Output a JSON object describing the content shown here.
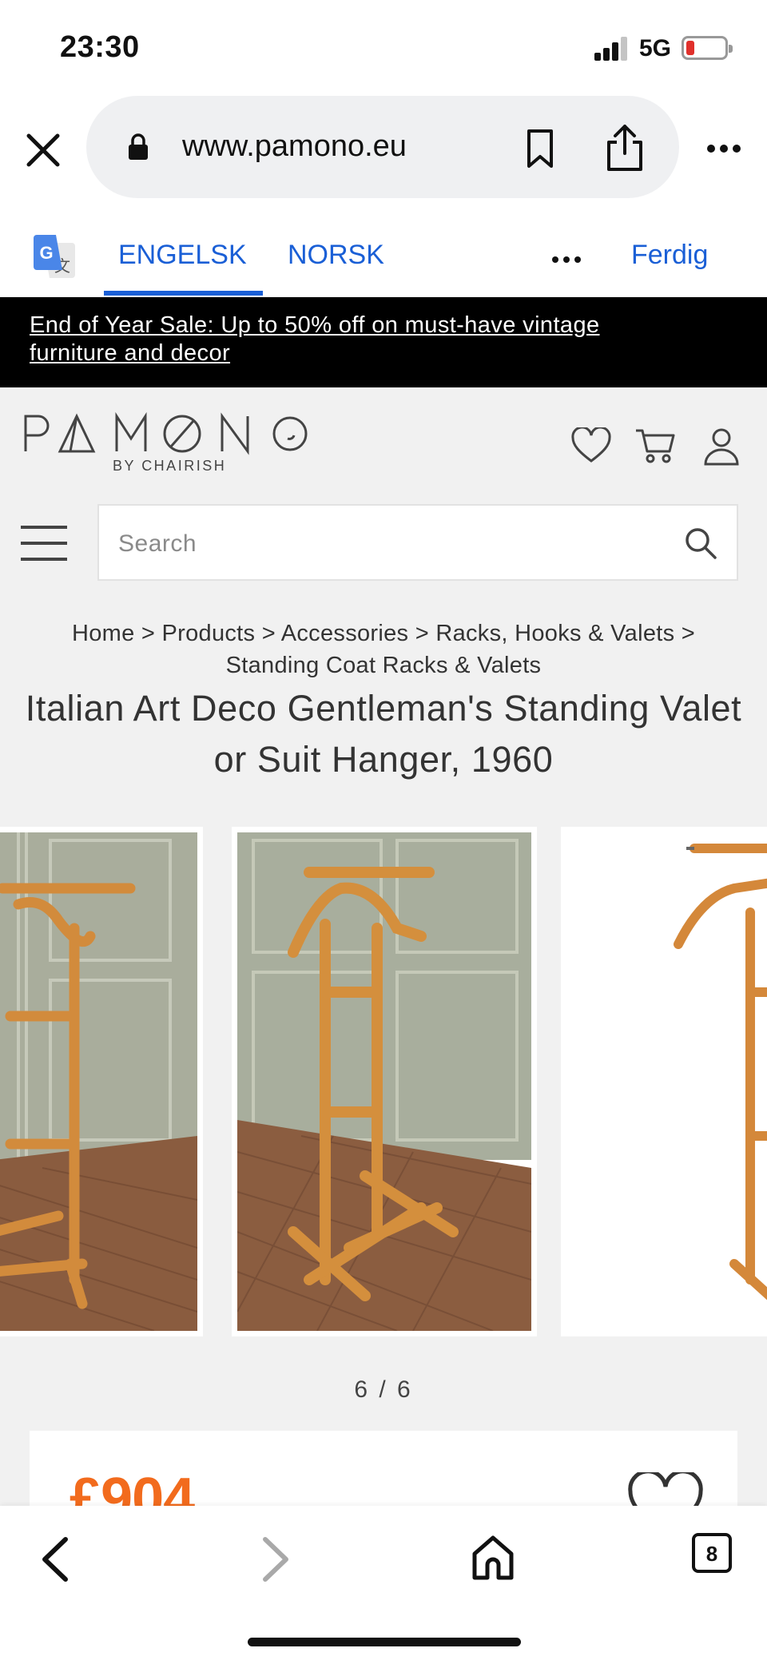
{
  "status_bar": {
    "time": "23:30",
    "network": "5G",
    "battery_color": "#e0302b"
  },
  "browser": {
    "url": "www.pamono.eu",
    "icons": [
      "close-icon",
      "lock-icon",
      "bookmark-icon",
      "share-icon",
      "more-icon"
    ]
  },
  "translate": {
    "source_lang": "ENGELSK",
    "target_lang": "NORSK",
    "done_label": "Ferdig",
    "accent": "#1a5fd6"
  },
  "banner": {
    "text": "End of Year Sale: Up to 50% off on must-have vintage furniture and decor"
  },
  "site": {
    "logo_sub": "BY CHAIRISH",
    "search_placeholder": "Search"
  },
  "breadcrumb": {
    "items": [
      "Home",
      "Products",
      "Accessories",
      "Racks, Hooks & Valets",
      "Standing Coat Racks & Valets"
    ],
    "separator": ">"
  },
  "product": {
    "title": "Italian Art Deco Gentleman's Standing Valet or Suit Hanger, 1960",
    "image_counter": "6 / 6",
    "price": "£904",
    "price_color": "#f26b1d"
  },
  "toolbar": {
    "tab_count": "8"
  }
}
